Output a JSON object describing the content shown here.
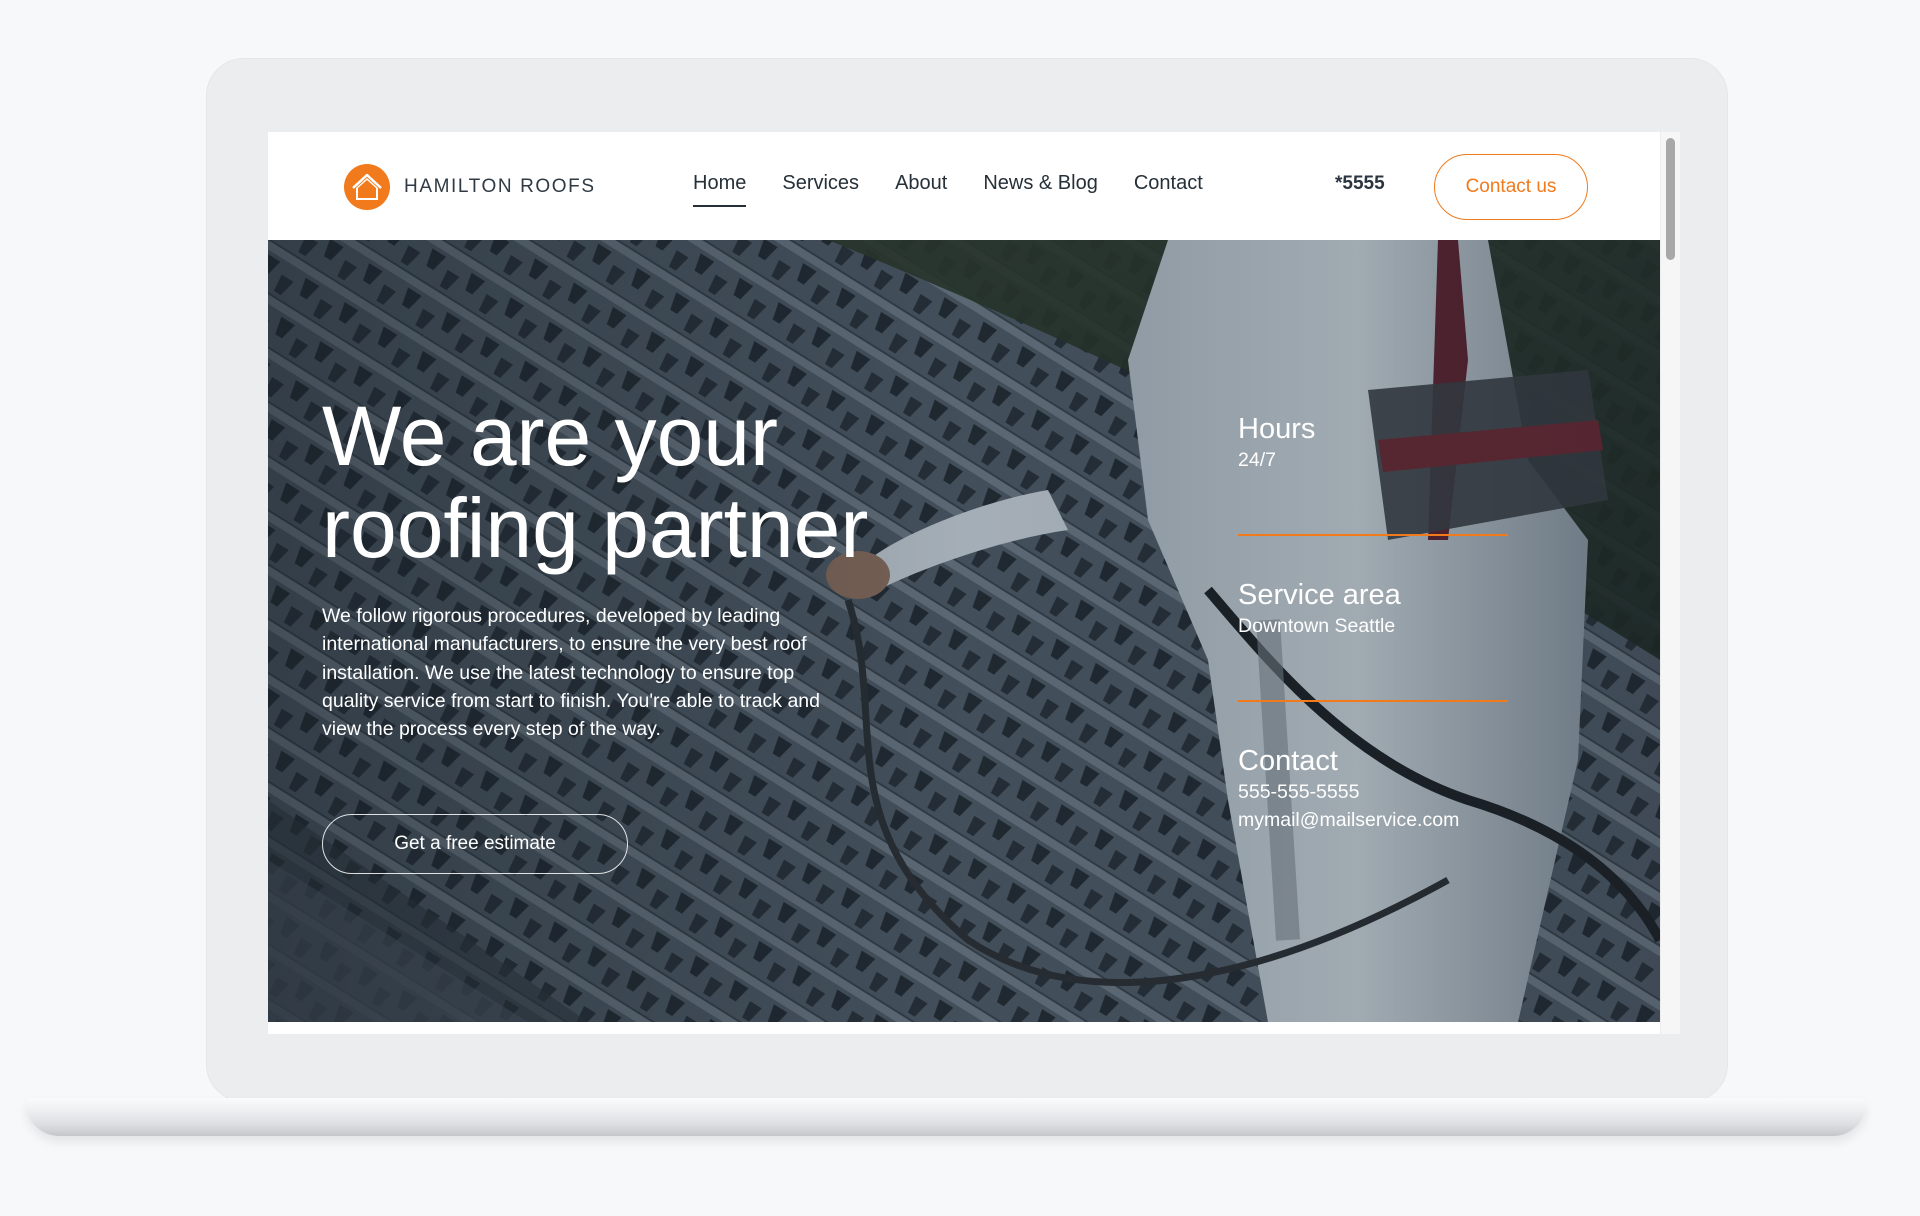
{
  "brand": {
    "name": "HAMILTON ROOFS",
    "accent_color": "#f07a1c"
  },
  "nav": {
    "items": [
      {
        "label": "Home",
        "active": true
      },
      {
        "label": "Services",
        "active": false
      },
      {
        "label": "About",
        "active": false
      },
      {
        "label": "News & Blog",
        "active": false
      },
      {
        "label": "Contact",
        "active": false
      }
    ]
  },
  "header": {
    "phone_short": "*5555",
    "cta_label": "Contact us"
  },
  "hero": {
    "title_line1": "We are your",
    "title_line2": "roofing partner",
    "description": "We follow rigorous procedures, developed by leading international manufacturers, to ensure the very best roof installation. We use the latest technology to ensure top quality service from start to finish. You're able to track and view the process every step of the way.",
    "cta_label": "Get a free estimate"
  },
  "info": {
    "hours_title": "Hours",
    "hours_value": "24/7",
    "service_title": "Service area",
    "service_value": "Downtown Seattle",
    "contact_title": "Contact",
    "contact_phone": "555-555-5555",
    "contact_email": "mymail@mailservice.com"
  }
}
